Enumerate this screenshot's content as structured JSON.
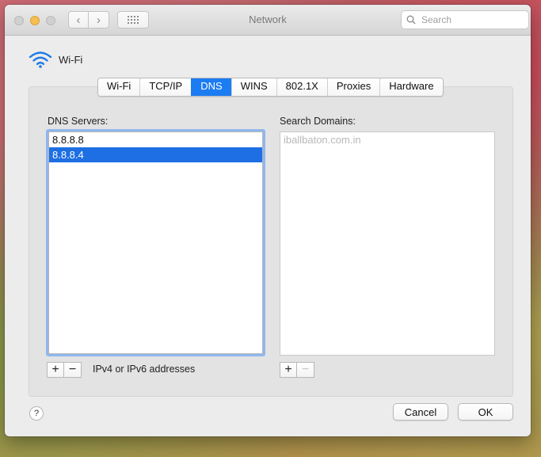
{
  "window": {
    "title": "Network"
  },
  "toolbar": {
    "search_placeholder": "Search",
    "back_glyph": "‹",
    "forward_glyph": "›"
  },
  "interface": {
    "name": "Wi-Fi",
    "icon": "wifi-icon"
  },
  "tabs": [
    {
      "label": "Wi-Fi",
      "active": false
    },
    {
      "label": "TCP/IP",
      "active": false
    },
    {
      "label": "DNS",
      "active": true
    },
    {
      "label": "WINS",
      "active": false
    },
    {
      "label": "802.1X",
      "active": false
    },
    {
      "label": "Proxies",
      "active": false
    },
    {
      "label": "Hardware",
      "active": false
    }
  ],
  "dns": {
    "label": "DNS Servers:",
    "servers": [
      "8.8.8.8",
      "8.8.8.4"
    ],
    "selected_index": 1,
    "add_label": "+",
    "remove_label": "−",
    "hint": "IPv4 or IPv6 addresses"
  },
  "search_domains": {
    "label": "Search Domains:",
    "placeholder_entry": "iballbaton.com.in",
    "add_label": "+",
    "remove_label": "−"
  },
  "footer": {
    "help_label": "?",
    "cancel_label": "Cancel",
    "ok_label": "OK"
  },
  "colors": {
    "accent": "#1c7cf2",
    "selection": "#1d6fe3"
  }
}
